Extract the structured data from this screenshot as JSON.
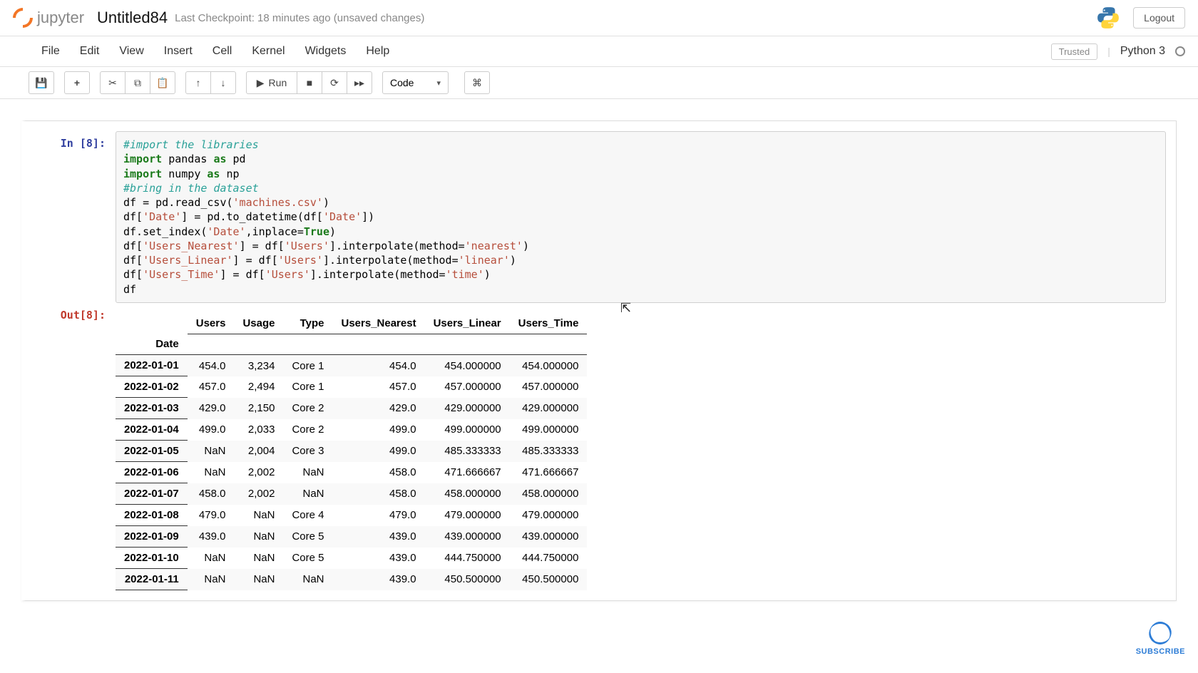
{
  "header": {
    "brand": "jupyter",
    "notebook_title": "Untitled84",
    "checkpoint": "Last Checkpoint: 18 minutes ago  (unsaved changes)",
    "logout": "Logout"
  },
  "menus": [
    "File",
    "Edit",
    "View",
    "Insert",
    "Cell",
    "Kernel",
    "Widgets",
    "Help"
  ],
  "kernel": {
    "trusted": "Trusted",
    "name": "Python 3"
  },
  "toolbar": {
    "run": "Run",
    "cell_type": "Code"
  },
  "cell": {
    "in_prompt": "In [8]:",
    "out_prompt": "Out[8]:",
    "code_lines": [
      {
        "cls": "cm-comment",
        "t": "#import the libraries"
      },
      {
        "kind": "import",
        "kw": "import",
        "mod": "pandas",
        "as": "as",
        "alias": "pd"
      },
      {
        "kind": "import",
        "kw": "import",
        "mod": "numpy",
        "as": "as",
        "alias": "np"
      },
      {
        "cls": "cm-comment",
        "t": "#bring in the dataset"
      },
      {
        "kind": "read",
        "pre": "df = pd.read_csv(",
        "str": "'machines.csv'",
        "post": ")"
      },
      {
        "kind": "date",
        "pre": "df[",
        "s1": "'Date'",
        "mid": "] = pd.to_datetime(df[",
        "s2": "'Date'",
        "post": "])"
      },
      {
        "kind": "setidx",
        "pre": "df.set_index(",
        "s1": "'Date'",
        "mid": ",inplace=",
        "kw": "True",
        "post": ")"
      },
      {
        "kind": "interp",
        "pre": "df[",
        "s1": "'Users_Nearest'",
        "mid1": "] = df[",
        "s2": "'Users'",
        "mid2": "].interpolate(method=",
        "s3": "'nearest'",
        "post": ")"
      },
      {
        "kind": "interp",
        "pre": "df[",
        "s1": "'Users_Linear'",
        "mid1": "] = df[",
        "s2": "'Users'",
        "mid2": "].interpolate(method=",
        "s3": "'linear'",
        "post": ")"
      },
      {
        "kind": "interp",
        "pre": "df[",
        "s1": "'Users_Time'",
        "mid1": "] = df[",
        "s2": "'Users'",
        "mid2": "].interpolate(method=",
        "s3": "'time'",
        "post": ")"
      },
      {
        "cls": "",
        "t": "df"
      }
    ]
  },
  "chart_data": {
    "type": "table",
    "index_name": "Date",
    "columns": [
      "Users",
      "Usage",
      "Type",
      "Users_Nearest",
      "Users_Linear",
      "Users_Time"
    ],
    "rows": [
      {
        "Date": "2022-01-01",
        "Users": "454.0",
        "Usage": "3,234",
        "Type": "Core 1",
        "Users_Nearest": "454.0",
        "Users_Linear": "454.000000",
        "Users_Time": "454.000000"
      },
      {
        "Date": "2022-01-02",
        "Users": "457.0",
        "Usage": "2,494",
        "Type": "Core 1",
        "Users_Nearest": "457.0",
        "Users_Linear": "457.000000",
        "Users_Time": "457.000000"
      },
      {
        "Date": "2022-01-03",
        "Users": "429.0",
        "Usage": "2,150",
        "Type": "Core 2",
        "Users_Nearest": "429.0",
        "Users_Linear": "429.000000",
        "Users_Time": "429.000000"
      },
      {
        "Date": "2022-01-04",
        "Users": "499.0",
        "Usage": "2,033",
        "Type": "Core 2",
        "Users_Nearest": "499.0",
        "Users_Linear": "499.000000",
        "Users_Time": "499.000000"
      },
      {
        "Date": "2022-01-05",
        "Users": "NaN",
        "Usage": "2,004",
        "Type": "Core 3",
        "Users_Nearest": "499.0",
        "Users_Linear": "485.333333",
        "Users_Time": "485.333333"
      },
      {
        "Date": "2022-01-06",
        "Users": "NaN",
        "Usage": "2,002",
        "Type": "NaN",
        "Users_Nearest": "458.0",
        "Users_Linear": "471.666667",
        "Users_Time": "471.666667"
      },
      {
        "Date": "2022-01-07",
        "Users": "458.0",
        "Usage": "2,002",
        "Type": "NaN",
        "Users_Nearest": "458.0",
        "Users_Linear": "458.000000",
        "Users_Time": "458.000000"
      },
      {
        "Date": "2022-01-08",
        "Users": "479.0",
        "Usage": "NaN",
        "Type": "Core 4",
        "Users_Nearest": "479.0",
        "Users_Linear": "479.000000",
        "Users_Time": "479.000000"
      },
      {
        "Date": "2022-01-09",
        "Users": "439.0",
        "Usage": "NaN",
        "Type": "Core 5",
        "Users_Nearest": "439.0",
        "Users_Linear": "439.000000",
        "Users_Time": "439.000000"
      },
      {
        "Date": "2022-01-10",
        "Users": "NaN",
        "Usage": "NaN",
        "Type": "Core 5",
        "Users_Nearest": "439.0",
        "Users_Linear": "444.750000",
        "Users_Time": "444.750000"
      },
      {
        "Date": "2022-01-11",
        "Users": "NaN",
        "Usage": "NaN",
        "Type": "NaN",
        "Users_Nearest": "439.0",
        "Users_Linear": "450.500000",
        "Users_Time": "450.500000"
      }
    ]
  },
  "subscribe": "SUBSCRIBE"
}
